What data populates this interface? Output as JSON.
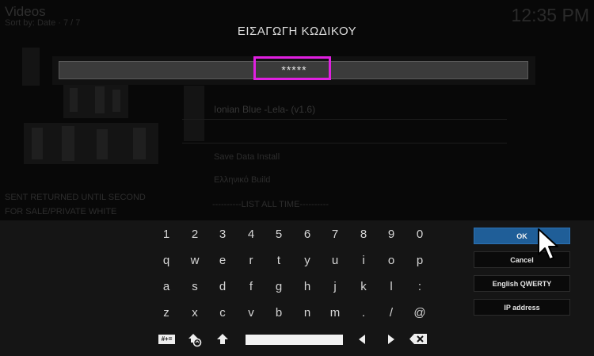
{
  "background": {
    "window_title": "Videos",
    "sort_info": "Sort by: Date  ·  7 / 7",
    "clock": "12:35 PM",
    "items": [
      "Ionian Blue -Lela- (v1.6)",
      "Save Data Install",
      "Ελληνικό Build",
      "----------LIST ALL TIME----------"
    ],
    "side_text": [
      "SENT RETURNED UNTIL SECOND",
      "FOR SALE/PRIVATE WHITE"
    ]
  },
  "dialog": {
    "title": "ΕΙΣΑΓΩΓΗ ΚΩΔΙΚΟΥ",
    "input_value": "*****"
  },
  "keyboard": {
    "row1": [
      "1",
      "2",
      "3",
      "4",
      "5",
      "6",
      "7",
      "8",
      "9",
      "0"
    ],
    "row2": [
      "q",
      "w",
      "e",
      "r",
      "t",
      "y",
      "u",
      "i",
      "o",
      "p"
    ],
    "row3": [
      "a",
      "s",
      "d",
      "f",
      "g",
      "h",
      "j",
      "k",
      "l",
      ":"
    ],
    "row4": [
      "z",
      "x",
      "c",
      "v",
      "b",
      "n",
      "m",
      ".",
      "/",
      "@"
    ],
    "symbols_label": "#+=",
    "icons": [
      "symbols-icon",
      "layout-switch-icon",
      "shift-icon",
      "space-bar",
      "cursor-left-icon",
      "cursor-right-icon",
      "backspace-icon"
    ]
  },
  "buttons": {
    "ok": "OK",
    "cancel": "Cancel",
    "layout": "English QWERTY",
    "ip": "IP address"
  },
  "colors": {
    "focused_button": "#1f5e98",
    "highlight": "#e020e0",
    "panel": "#151515"
  }
}
